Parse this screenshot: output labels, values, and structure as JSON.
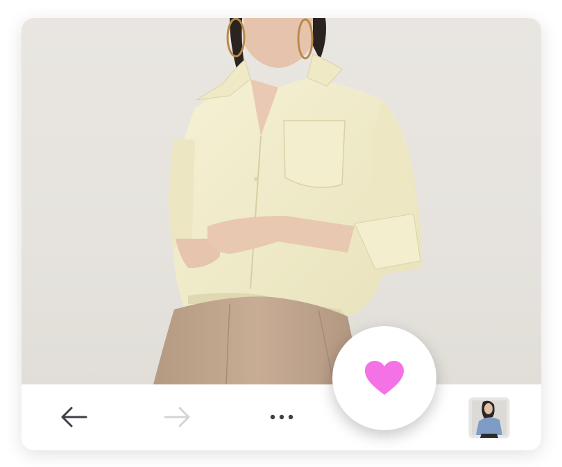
{
  "product_photo": {
    "description_icon": "product-photo",
    "colors": {
      "background": "#e7e4df",
      "shirt": "#f1ecc9",
      "trousers": "#bfa58d",
      "skin": "#e9c9b3"
    }
  },
  "toolbar": {
    "back_icon": "arrow-left-icon",
    "forward_icon": "arrow-right-icon",
    "forward_enabled": false,
    "more_icon": "more-dots-icon",
    "thumbnail_icon": "product-thumbnail"
  },
  "like_button": {
    "icon": "heart-icon",
    "color": "#f472e6"
  }
}
